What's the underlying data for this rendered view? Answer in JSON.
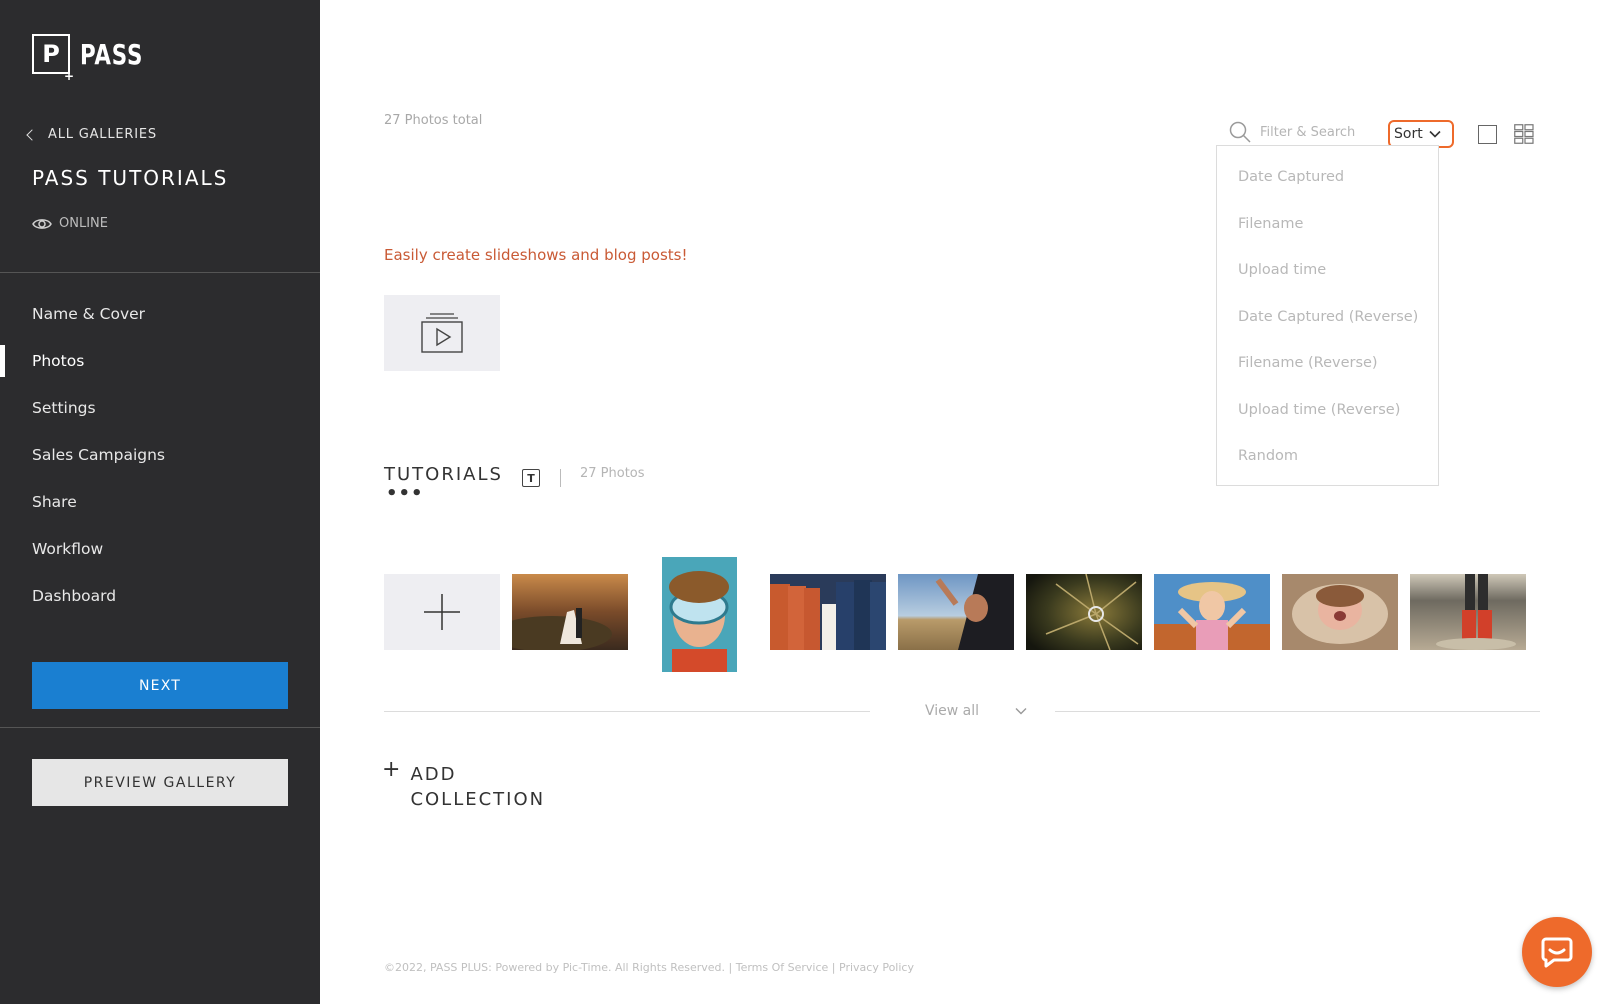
{
  "brand": {
    "logo_letter": "P",
    "logo_text": "PASS"
  },
  "sidebar": {
    "back_label": "ALL GALLERIES",
    "gallery_title": "PASS TUTORIALS",
    "status": "ONLINE",
    "nav": [
      {
        "label": "Name & Cover"
      },
      {
        "label": "Photos",
        "active": true
      },
      {
        "label": "Settings"
      },
      {
        "label": "Sales Campaigns"
      },
      {
        "label": "Share"
      },
      {
        "label": "Workflow"
      },
      {
        "label": "Dashboard"
      }
    ],
    "next_label": "NEXT",
    "preview_label": "PREVIEW GALLERY"
  },
  "toolbar": {
    "photos_total": "27 Photos total",
    "search_placeholder": "Filter & Search",
    "sort_label": "Sort"
  },
  "sort_menu": {
    "options": [
      "Date Captured",
      "Filename",
      "Upload time",
      "Date Captured (Reverse)",
      "Filename (Reverse)",
      "Upload time (Reverse)",
      "Random"
    ]
  },
  "promo": {
    "text": "Easily create slideshows and blog posts!"
  },
  "collection": {
    "title": "TUTORIALS",
    "type_icon": "T",
    "count": "27 Photos",
    "thumbnails": [
      {
        "subject": "couple-landscape"
      },
      {
        "subject": "child-snorkel-mask"
      },
      {
        "subject": "wedding-party"
      },
      {
        "subject": "car-window-woman"
      },
      {
        "subject": "ring-macro"
      },
      {
        "subject": "woman-hat"
      },
      {
        "subject": "newborn"
      },
      {
        "subject": "rain-boots"
      }
    ],
    "view_all": "View all"
  },
  "add_collection": {
    "line1": "ADD",
    "line2": "COLLECTION"
  },
  "footer": {
    "copyright": "©2022, PASS PLUS: Powered by Pic-Time. All Rights Reserved.",
    "separator": "|",
    "terms": "Terms Of Service",
    "privacy": "Privacy Policy"
  },
  "colors": {
    "sidebar_bg": "#2c2c2e",
    "accent_orange": "#ee6a2b",
    "next_blue": "#1a7fd1",
    "promo_text": "#c95a35"
  }
}
